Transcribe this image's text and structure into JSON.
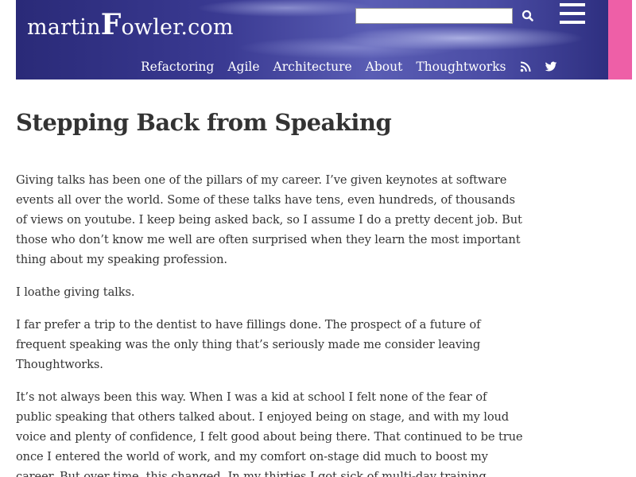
{
  "site": {
    "logo_prefix": "martin",
    "logo_big": "F",
    "logo_suffix": "owler.com",
    "search_placeholder": "",
    "colors": {
      "banner_dark": "#2a2a78",
      "banner_light": "#5a5db4",
      "accent_stripe": "#ee5fa7",
      "text": "#333333"
    },
    "icons": [
      "search-icon",
      "hamburger-menu-icon",
      "rss-icon",
      "twitter-icon"
    ]
  },
  "nav": {
    "items": [
      {
        "label": "Refactoring"
      },
      {
        "label": "Agile"
      },
      {
        "label": "Architecture"
      },
      {
        "label": "About"
      },
      {
        "label": "Thoughtworks"
      }
    ]
  },
  "article": {
    "title": "Stepping Back from Speaking",
    "paragraphs": [
      "Giving talks has been one of the pillars of my career. I’ve given keynotes at software events all over the world. Some of these talks have tens, even hundreds, of thousands of views on youtube. I keep being asked back, so I assume I do a pretty decent job. But those who don’t know me well are often surprised when they learn the most important thing about my speaking profession.",
      "I loathe giving talks.",
      "I far prefer a trip to the dentist to have fillings done. The prospect of a future of frequent speaking was the only thing that’s seriously made me consider leaving Thoughtworks.",
      "It’s not always been this way. When I was a kid at school I felt none of the fear of public speaking that others talked about. I enjoyed being on stage, and with my loud voice and plenty of confidence, I felt good about being there. That continued to be true once I entered the world of work, and my comfort on-stage did much to boost my career. But over time, this changed. In my thirties I got sick of multi-day training"
    ]
  }
}
